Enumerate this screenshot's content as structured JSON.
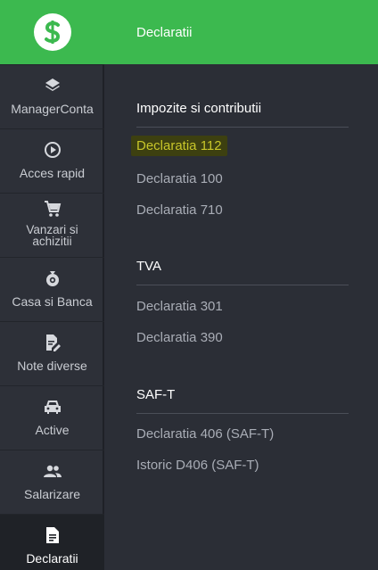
{
  "header": {
    "title": "Declaratii"
  },
  "logo": {
    "icon": "dollar-icon",
    "color": "#3cb94f"
  },
  "sidebar": {
    "items": [
      {
        "label": "ManagerConta",
        "icon": "layers-icon"
      },
      {
        "label": "Acces rapid",
        "icon": "play-circle-icon"
      },
      {
        "label": "Vanzari si achizitii",
        "icon": "cart-icon"
      },
      {
        "label": "Casa si Banca",
        "icon": "money-bag-icon"
      },
      {
        "label": "Note diverse",
        "icon": "edit-document-icon"
      },
      {
        "label": "Active",
        "icon": "car-icon"
      },
      {
        "label": "Salarizare",
        "icon": "people-icon"
      },
      {
        "label": "Declaratii",
        "icon": "document-icon",
        "active": true
      }
    ]
  },
  "sections": [
    {
      "title": "Impozite si contributii",
      "links": [
        "Declaratia 112",
        "Declaratia 100",
        "Declaratia 710"
      ]
    },
    {
      "title": "TVA",
      "links": [
        "Declaratia 301",
        "Declaratia 390"
      ]
    },
    {
      "title": "SAF-T",
      "links": [
        "Declaratia 406 (SAF-T)",
        "Istoric D406 (SAF-T)"
      ]
    }
  ],
  "highlight_color": "#c8c62a"
}
